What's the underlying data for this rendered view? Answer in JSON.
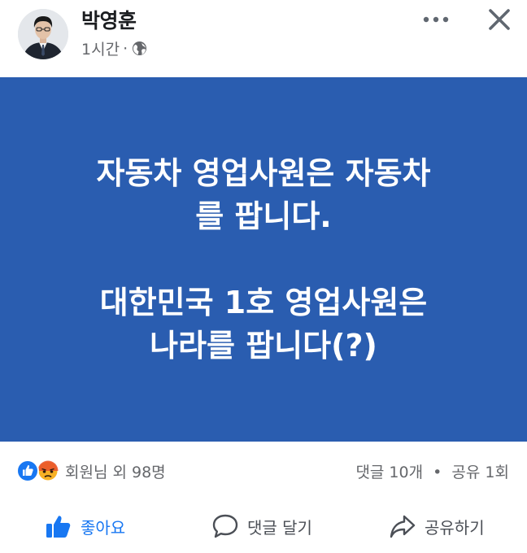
{
  "post": {
    "author": "박영훈",
    "time": "1시간",
    "separator": "·",
    "privacy_icon": "globe-icon",
    "body": {
      "paragraph1_line1": "자동차 영업사원은 자동차",
      "paragraph1_line2": "를 팝니다.",
      "paragraph2_line1": "대한민국 1호 영업사원은",
      "paragraph2_line2": "나라를 팝니다(?)"
    },
    "background_color": "#2a5db0"
  },
  "header_icons": {
    "more": "more-horizontal-icon",
    "close": "close-icon"
  },
  "stats": {
    "reactions": [
      "like-reaction-icon",
      "angry-reaction-icon"
    ],
    "reaction_text": "회원님 외 98명",
    "comments_text": "댓글 10개",
    "dot": "•",
    "shares_text": "공유 1회"
  },
  "actions": {
    "like_label": "좋아요",
    "comment_label": "댓글 달기",
    "share_label": "공유하기"
  },
  "colors": {
    "accent": "#1877f2",
    "angry": "#f7b125",
    "secondary_text": "#65676b"
  }
}
